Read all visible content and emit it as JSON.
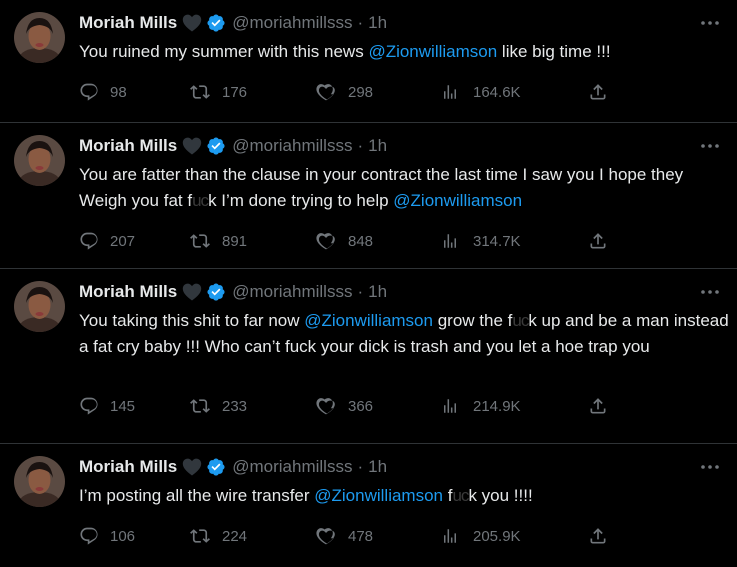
{
  "colors": {
    "background": "#000000",
    "text": "#e7e9ea",
    "muted": "#71767b",
    "link": "#1d9bf0",
    "divider": "#2f3336",
    "verified": "#1d9bf0"
  },
  "icons": {
    "reply": "reply-icon",
    "retweet": "retweet-icon",
    "like": "like-icon",
    "views": "views-icon",
    "share": "share-icon",
    "more": "more-icon",
    "verified": "verified-badge-icon",
    "black_heart": "black-heart-emoji"
  },
  "tweets": [
    {
      "name": "Moriah Mills",
      "handle": "@moriahmillsss",
      "separator": "·",
      "time": "1h",
      "text": {
        "parts": [
          "You ruined my summer with this news ",
          "@Zionwilliamson",
          " like big time !!!"
        ]
      },
      "stats": {
        "replies": "98",
        "retweets": "176",
        "likes": "298",
        "views": "164.6K"
      }
    },
    {
      "name": "Moriah Mills",
      "handle": "@moriahmillsss",
      "separator": "·",
      "time": "1h",
      "text": {
        "parts": [
          "You are fatter than the clause in your contract the last time I saw you I hope they Weigh you fat f",
          "uc",
          "k I’m done trying to help ",
          "@Zionwilliamson"
        ]
      },
      "stats": {
        "replies": "207",
        "retweets": "891",
        "likes": "848",
        "views": "314.7K"
      }
    },
    {
      "name": "Moriah Mills",
      "handle": "@moriahmillsss",
      "separator": "·",
      "time": "1h",
      "text": {
        "parts": [
          "You taking this shit to far now ",
          "@Zionwilliamson",
          " grow the f",
          "uc",
          "k up and be a man instead a fat cry baby !!! Who can’t fuck your dick is trash and you let a hoe trap you"
        ]
      },
      "stats": {
        "replies": "145",
        "retweets": "233",
        "likes": "366",
        "views": "214.9K"
      }
    },
    {
      "name": "Moriah Mills",
      "handle": "@moriahmillsss",
      "separator": "·",
      "time": "1h",
      "text": {
        "parts": [
          "I’m posting all the wire transfer ",
          "@Zionwilliamson",
          " f",
          "uc",
          "k you !!!!"
        ]
      },
      "stats": {
        "replies": "106",
        "retweets": "224",
        "likes": "478",
        "views": "205.9K"
      }
    }
  ]
}
